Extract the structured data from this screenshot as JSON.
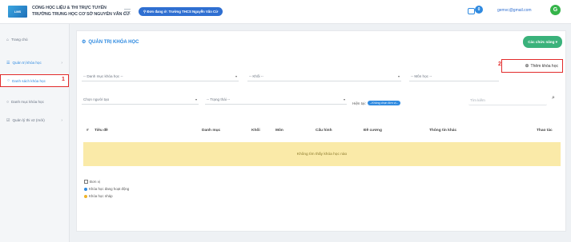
{
  "header": {
    "logo_text": "LMS",
    "brand_line1": "CỔNG HỌC LIỆU & THI TRỰC TUYẾN",
    "brand_line2": "TRƯỜNG TRUNG HỌC CƠ SỞ NGUYỄN VĂN CỪ",
    "school_pill": "⚲ Đơn đang ở: Trường THCS Nguyễn Văn Cừ",
    "notification_count": "0",
    "user_email": "gemvc@gmail.com",
    "avatar_letter": "G"
  },
  "sidebar": {
    "items": [
      {
        "icon": "home-icon",
        "label": "Trang chủ"
      },
      {
        "icon": "course-management-icon",
        "label": "Quản trị khóa học"
      },
      {
        "icon": "list-icon",
        "label": "Danh sách khóa học"
      },
      {
        "icon": "category-icon",
        "label": "Danh mục khóa học"
      },
      {
        "icon": "exam-icon",
        "label": "Quản lý thi v2 (mới)"
      }
    ]
  },
  "main": {
    "title": "QUẢN TRỊ KHÓA HỌC",
    "functions_button": "Các chức năng ▾",
    "add_course_label": "Thêm khóa học",
    "annotations": [
      "1",
      "2"
    ],
    "filters": {
      "category": "-- Danh mục khóa học --",
      "grade": "-- Khối --",
      "subject": "-- Môn học --",
      "creator": "Chọn người tạo",
      "status": "-- Trạng thái --",
      "current_label": "Hiện tại:",
      "current_value": "--Không chọn đơn vị--",
      "search_placeholder": "Tìm kiếm"
    },
    "table": {
      "columns": [
        "#",
        "Tiêu đề",
        "Danh mục",
        "Khối",
        "Môn",
        "Cấu hình",
        "Đề cương",
        "Thông tin khác",
        "Thao tác"
      ],
      "empty_message": "Không tìm thấy khóa học nào"
    },
    "legend": {
      "title": "Đơn vị",
      "items": [
        {
          "label": "Khóa học đang hoạt động",
          "color": "#2f8ae0"
        },
        {
          "label": "Khóa học nháp",
          "color": "#f0b429"
        }
      ]
    }
  },
  "colors": {
    "primary": "#2f8ae0",
    "success": "#3ab27b",
    "highlight": "#e22b2b",
    "warning_bg": "#faeaa8"
  }
}
